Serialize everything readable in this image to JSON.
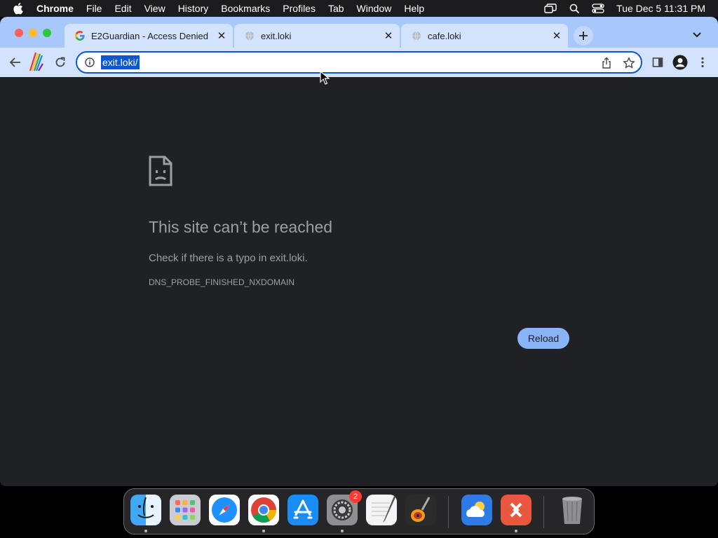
{
  "menubar": {
    "app_name": "Chrome",
    "items": [
      "File",
      "Edit",
      "View",
      "History",
      "Bookmarks",
      "Profiles",
      "Tab",
      "Window",
      "Help"
    ],
    "clock": "Tue Dec 5  11:31 PM"
  },
  "tabs": [
    {
      "title": "E2Guardian - Access Denied",
      "icon": "google-icon"
    },
    {
      "title": "exit.loki",
      "icon": "globe-icon",
      "active": true
    },
    {
      "title": "cafe.loki",
      "icon": "globe-icon"
    }
  ],
  "omnibox": {
    "url": "exit.loki/"
  },
  "error": {
    "title": "This site can’t be reached",
    "description": "Check if there is a typo in exit.loki.",
    "code": "DNS_PROBE_FINISHED_NXDOMAIN",
    "reload_label": "Reload"
  },
  "dock": {
    "apps": [
      "Finder",
      "Launchpad",
      "Safari",
      "Chrome",
      "App Store",
      "System Settings",
      "TextEdit",
      "GarageBand",
      "Weather",
      "Remote Desktop",
      "Trash"
    ],
    "system_settings_badge": "2"
  },
  "colors": {
    "tabstrip": "#a8c7fa",
    "toolbar": "#d3e3fd",
    "page_bg": "#202124",
    "reload_button": "#8ab4f8"
  }
}
